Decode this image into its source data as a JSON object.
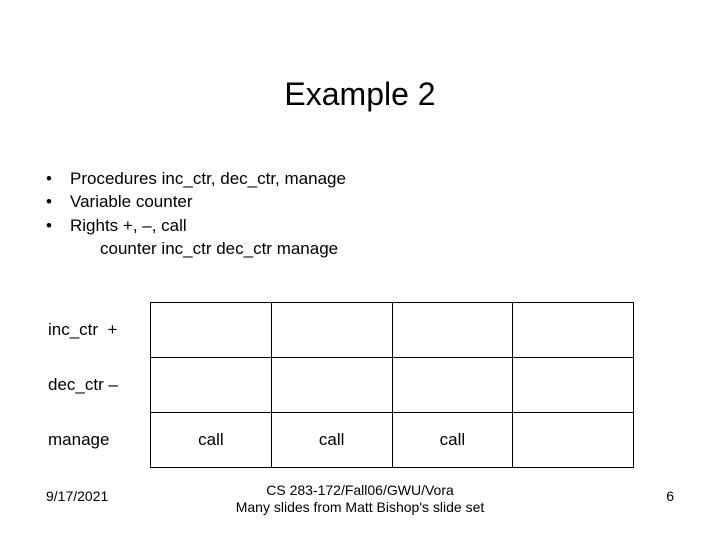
{
  "title": "Example 2",
  "bullets": {
    "b1": "Procedures inc_ctr, dec_ctr, manage",
    "b2": "Variable counter",
    "b3": "Rights +, –, call",
    "headers_line": "counter inc_ctr  dec_ctr manage"
  },
  "table": {
    "rows": [
      {
        "label": "inc_ctr",
        "col1": "+",
        "col2": "",
        "col3": "",
        "col4": "",
        "col5": ""
      },
      {
        "label": "dec_ctr",
        "col1": "–",
        "col2": "",
        "col3": "",
        "col4": "",
        "col5": ""
      },
      {
        "label": "manage",
        "col1": "",
        "col2": "call",
        "col3": "call",
        "col4": "call",
        "col5": ""
      }
    ]
  },
  "footer": {
    "date": "9/17/2021",
    "line1": "CS 283-172/Fall06/GWU/Vora",
    "line2": "Many slides from Matt Bishop's slide set",
    "pagenum": "6"
  }
}
